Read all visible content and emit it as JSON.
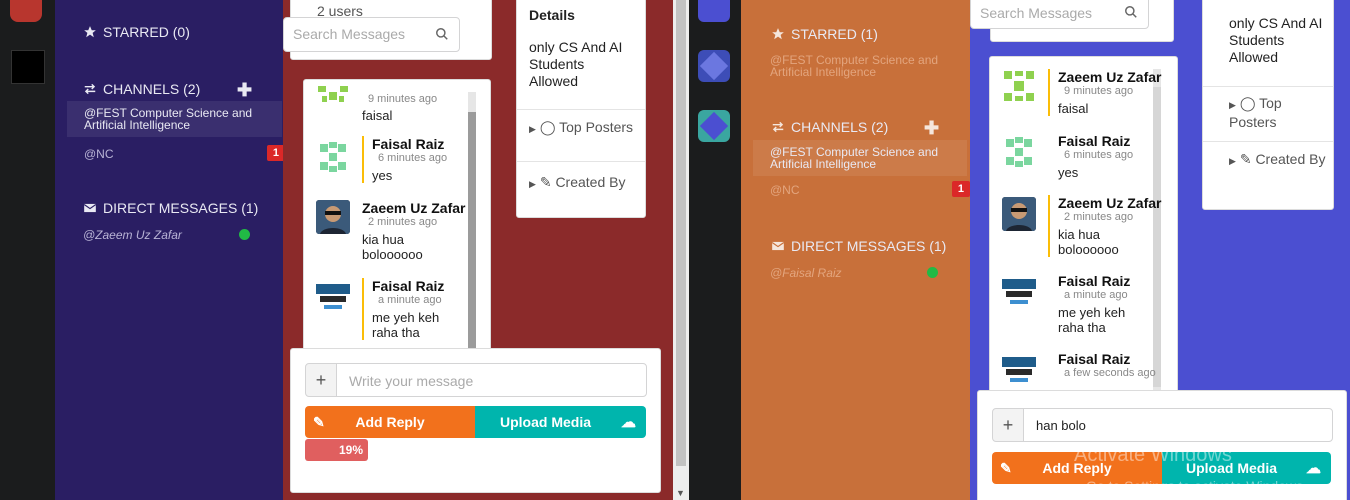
{
  "left": {
    "user_count": "2 users",
    "search_placeholder": "Search Messages",
    "starred": "STARRED (0)",
    "channels": "CHANNELS (2)",
    "channel_items": [
      {
        "label": "@FEST Computer Science and Artificial Intelligence"
      },
      {
        "label": "@NC",
        "badge": "1"
      }
    ],
    "direct_messages": "DIRECT MESSAGES (1)",
    "dm_user": "@Zaeem Uz Zafar",
    "messages": [
      {
        "name": "",
        "time": "9 minutes ago",
        "text": "faisal"
      },
      {
        "name": "Faisal Raiz",
        "time": "6 minutes ago",
        "text": "yes"
      },
      {
        "name": "Zaeem Uz Zafar",
        "time": "2 minutes ago",
        "text": "kia hua boloooooo"
      },
      {
        "name": "Faisal Raiz",
        "time": "a minute ago",
        "text": "me yeh keh raha tha"
      }
    ],
    "details_title": "Details",
    "details_desc": "only CS And AI Students Allowed",
    "top_posters": "Top Posters",
    "created_by": "Created By",
    "composer_placeholder": "Write your message",
    "add_reply": "Add Reply",
    "upload_media": "Upload Media",
    "progress_label": "19%"
  },
  "right": {
    "search_placeholder": "Search Messages",
    "starred": "STARRED (1)",
    "starred_item": "@FEST Computer Science and Artificial Intelligence",
    "channels": "CHANNELS (2)",
    "channel_items": [
      {
        "label": "@FEST Computer Science and Artificial Intelligence"
      },
      {
        "label": "@NC",
        "badge": "1"
      }
    ],
    "direct_messages": "DIRECT MESSAGES (1)",
    "dm_user": "@Faisal Raiz",
    "messages": [
      {
        "name": "Zaeem Uz Zafar",
        "time": "9 minutes ago",
        "text": "faisal"
      },
      {
        "name": "Faisal Raiz",
        "time": "6 minutes ago",
        "text": "yes"
      },
      {
        "name": "Zaeem Uz Zafar",
        "time": "2 minutes ago",
        "text": "kia hua boloooooo"
      },
      {
        "name": "Faisal Raiz",
        "time": "a minute ago",
        "text": "me yeh keh raha tha"
      },
      {
        "name": "Faisal Raiz",
        "time": "a few seconds ago",
        "text": ""
      }
    ],
    "details_desc": "only CS And AI Students Allowed",
    "top_posters": "Top Posters",
    "created_by": "Created By",
    "composer_value": "han bolo",
    "add_reply": "Add Reply",
    "upload_media": "Upload Media",
    "watermark_title": "Activate Windows",
    "watermark_sub": "Go to Settings to activate Windows."
  },
  "colors": {
    "left_sidebar": "#2a1e63",
    "left_main": "#8b2a2a",
    "right_sidebar": "#c8703a",
    "right_main": "#4b4fd1",
    "orange": "#f2711c",
    "teal": "#00b5ad",
    "red": "#db2828"
  }
}
